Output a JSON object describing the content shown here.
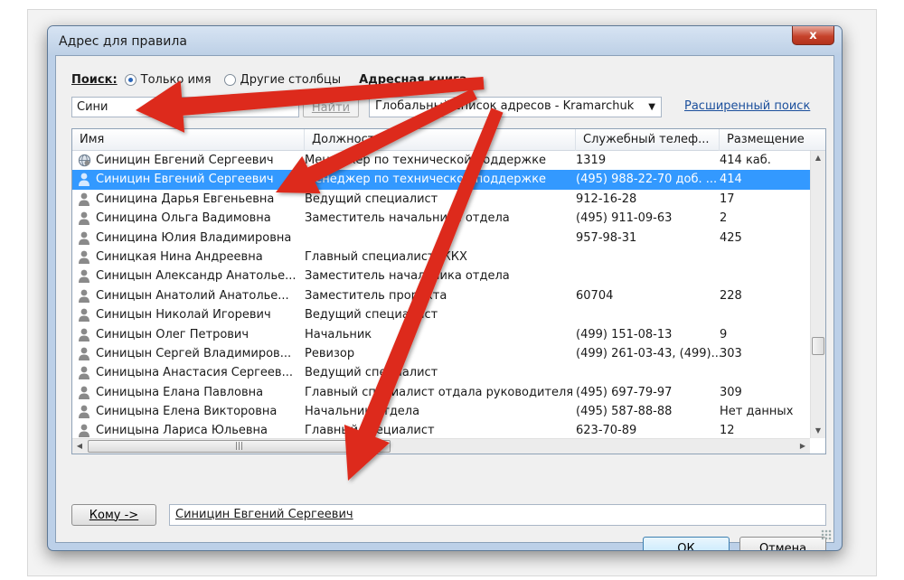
{
  "dialog": {
    "title": "Адрес для правила",
    "close_label": "x"
  },
  "search": {
    "label": "Поиск:",
    "option_name_only": "Только имя",
    "option_other_columns": "Другие столбцы",
    "address_book_label": "Адресная книга",
    "query_value": "Сини",
    "go_label": "Найти",
    "address_book_value": "Глобальный список адресов - Kramarchuk",
    "advanced_link": "Расширенный поиск"
  },
  "table": {
    "columns": [
      "Имя",
      "Должность",
      "Служебный телеф...",
      "Размещение"
    ],
    "rows": [
      {
        "icon": "globe",
        "name": "Синицин Евгений Сергеевич",
        "title": "Менеджер по технической поддержке",
        "phone": "1319",
        "location": "414 каб.",
        "selected": false
      },
      {
        "icon": "person",
        "name": "Синицин Евгений Сергеевич",
        "title": "Менеджер по технической поддержке",
        "phone": "(495) 988-22-70 доб. ...",
        "location": "414",
        "selected": true
      },
      {
        "icon": "person",
        "name": "Синицина Дарья Евгеньевна",
        "title": "Ведущий специалист",
        "phone": "912-16-28",
        "location": "17",
        "selected": false
      },
      {
        "icon": "person",
        "name": "Синицина Ольга Вадимовна",
        "title": "Заместитель начальника отдела",
        "phone": "(495) 911-09-63",
        "location": "2",
        "selected": false
      },
      {
        "icon": "person",
        "name": "Синицина Юлия Владимировна",
        "title": "",
        "phone": "957-98-31",
        "location": "425",
        "selected": false
      },
      {
        "icon": "person",
        "name": "Синицкая Нина Андреевна",
        "title": "Главный специалист ЖКХ",
        "phone": "",
        "location": "",
        "selected": false
      },
      {
        "icon": "person",
        "name": "Синицын Александр Анатолье...",
        "title": "Заместитель начальника отдела",
        "phone": "",
        "location": "",
        "selected": false
      },
      {
        "icon": "person",
        "name": "Синицын Анатолий Анатолье...",
        "title": "Заместитель проректа",
        "phone": "60704",
        "location": "228",
        "selected": false
      },
      {
        "icon": "person",
        "name": "Синицын Николай Игоревич",
        "title": "Ведущий специалист",
        "phone": "",
        "location": "",
        "selected": false
      },
      {
        "icon": "person",
        "name": "Синицын Олег Петрович",
        "title": "Начальник",
        "phone": "(499) 151-08-13",
        "location": "9",
        "selected": false
      },
      {
        "icon": "person",
        "name": "Синицын Сергей Владимиров...",
        "title": "Ревизор",
        "phone": "(499) 261-03-43, (499)...",
        "location": "303",
        "selected": false
      },
      {
        "icon": "person",
        "name": "Синицына Анастасия Сергеев...",
        "title": "Ведущий специалист",
        "phone": "",
        "location": "",
        "selected": false
      },
      {
        "icon": "person",
        "name": "Синицына Елана Павловна",
        "title": "Главный специалист отдала руководителя",
        "phone": "(495) 697-79-97",
        "location": "309",
        "selected": false
      },
      {
        "icon": "person",
        "name": "Синицына Елена Викторовна",
        "title": "Начальник отдела",
        "phone": "(495) 587-88-88",
        "location": "Нет данных",
        "selected": false
      },
      {
        "icon": "person",
        "name": "Синицына Лариса Юльевна",
        "title": "Главный специалист",
        "phone": "623-70-89",
        "location": "12",
        "selected": false
      }
    ]
  },
  "recipient": {
    "to_label": "Кому ->",
    "value": "Синицин Евгений Сергеевич"
  },
  "buttons": {
    "ok_label": "ОК",
    "cancel_label": "Отмена"
  },
  "colors": {
    "annotation_arrow": "#dd2c1c",
    "selection": "#3399ff",
    "link": "#1b4f9c"
  }
}
